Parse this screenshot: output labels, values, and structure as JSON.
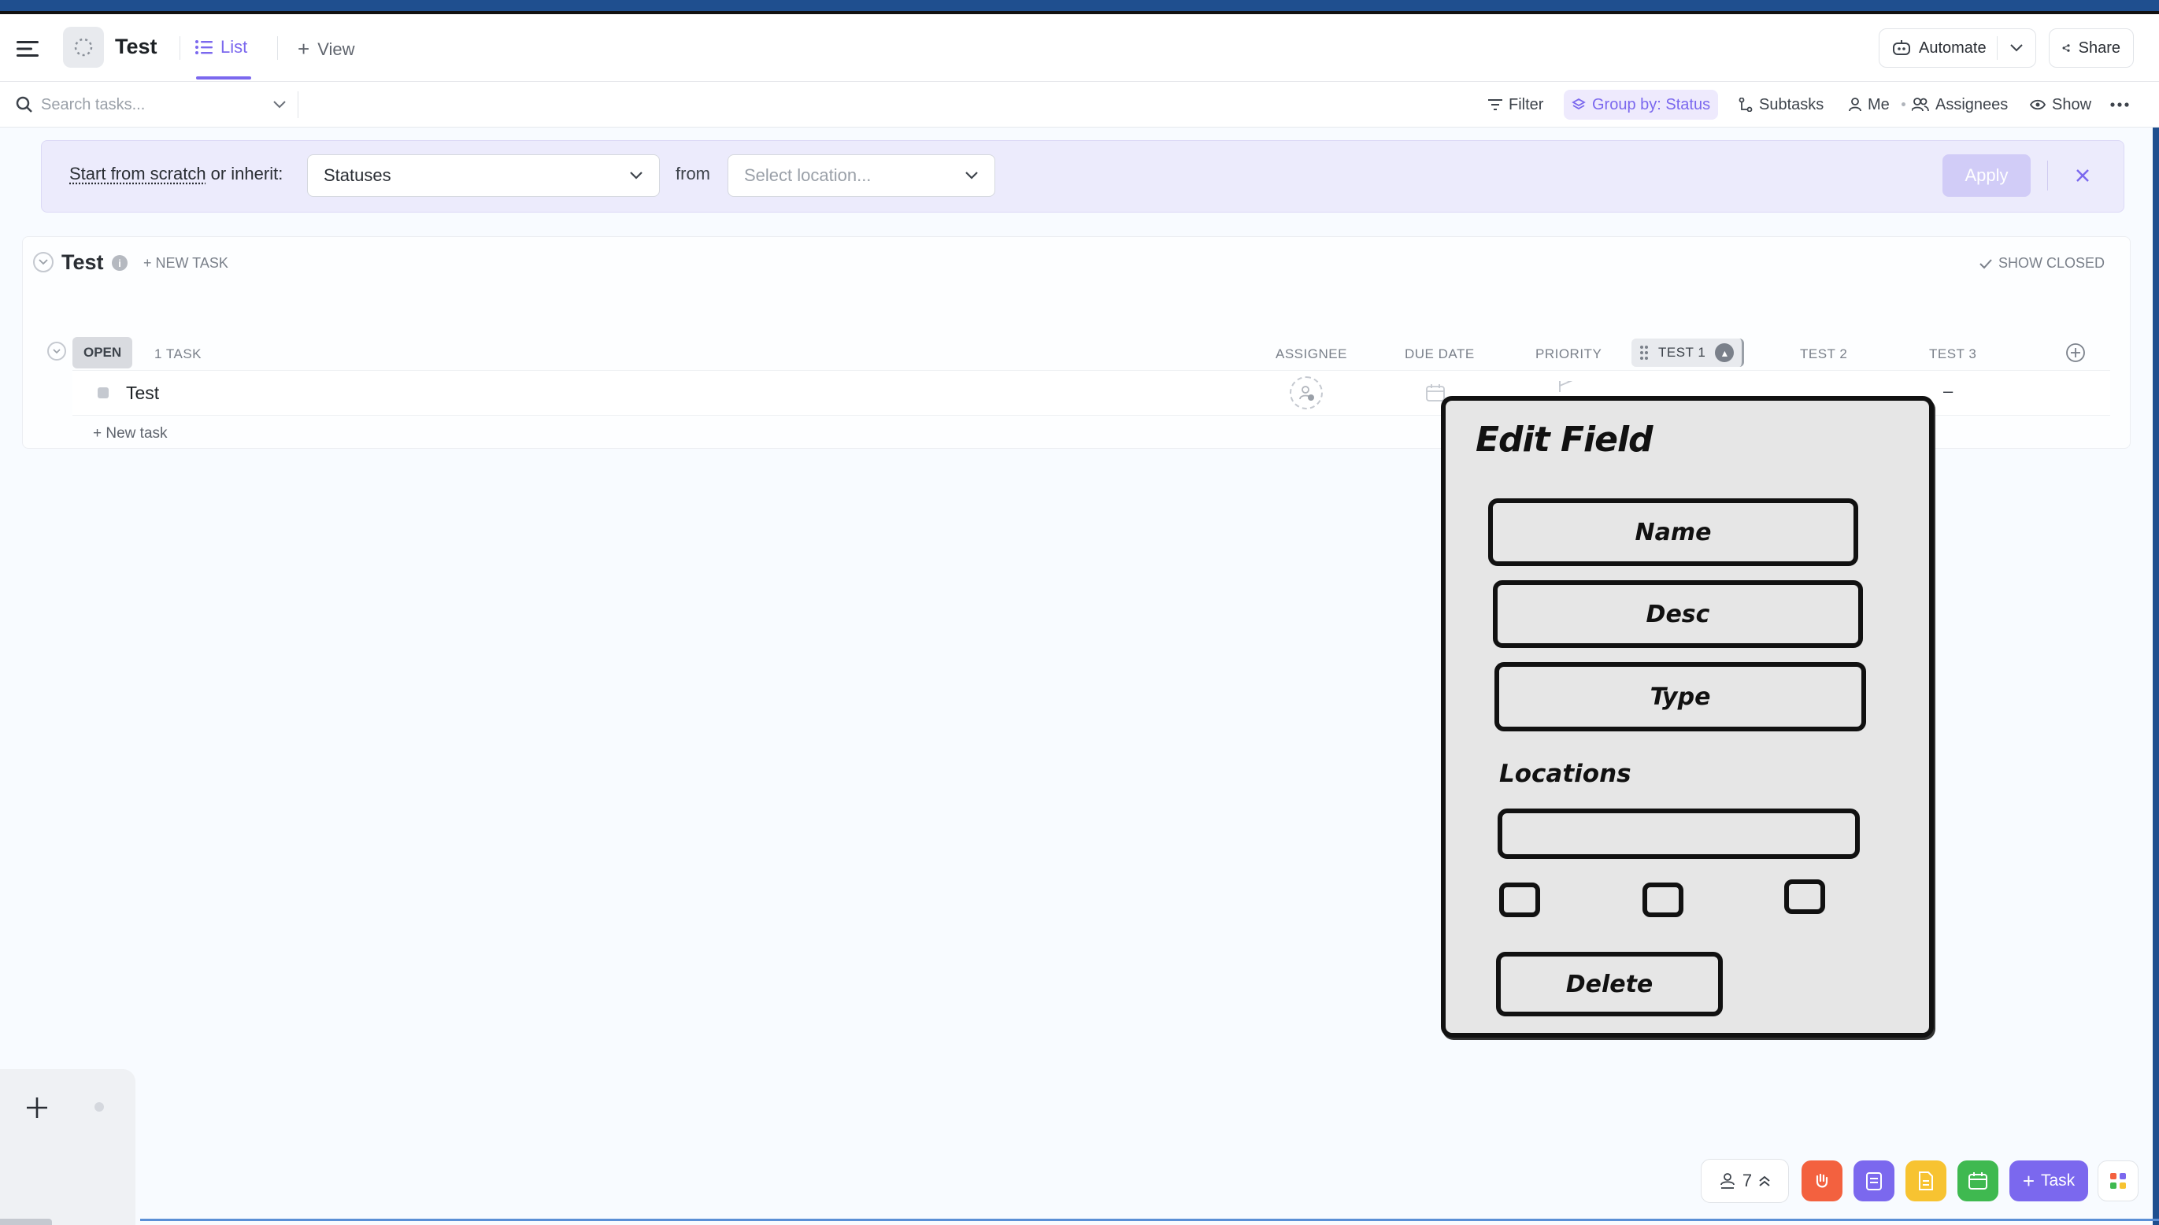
{
  "header": {
    "space_title": "Test",
    "tab_list_label": "List",
    "tab_view_label": "View",
    "automate_label": "Automate",
    "share_label": "Share"
  },
  "toolbar": {
    "search_placeholder": "Search tasks...",
    "filter_label": "Filter",
    "group_by_label": "Group by: Status",
    "subtasks_label": "Subtasks",
    "me_label": "Me",
    "assignees_label": "Assignees",
    "show_label": "Show"
  },
  "banner": {
    "start_from_scratch": "Start from scratch",
    "or_inherit": "or inherit:",
    "statuses_value": "Statuses",
    "from_label": "from",
    "location_placeholder": "Select location...",
    "apply_label": "Apply"
  },
  "list": {
    "title": "Test",
    "new_task_header": "+ NEW TASK",
    "show_closed": "SHOW CLOSED",
    "status": "OPEN",
    "task_count": "1 TASK",
    "columns": {
      "assignee": "ASSIGNEE",
      "due_date": "DUE DATE",
      "priority": "PRIORITY",
      "test1": "TEST 1",
      "test2": "TEST 2",
      "test3": "TEST 3"
    },
    "tasks": [
      {
        "name": "Test",
        "test3_value": "–"
      }
    ],
    "new_task_row": "+ New task"
  },
  "sketch": {
    "title": "Edit Field",
    "name_field": "Name",
    "desc_field": "Desc",
    "type_field": "Type",
    "locations_label": "Locations",
    "delete_button": "Delete"
  },
  "dock": {
    "count": "7",
    "task_label": "Task"
  },
  "colors": {
    "accent": "#7b68ee",
    "banner_bg": "#ecebfc",
    "dock_red": "#f3613f",
    "dock_purple": "#7b68ee",
    "dock_yellow": "#f7c331",
    "dock_green": "#3fb950"
  }
}
